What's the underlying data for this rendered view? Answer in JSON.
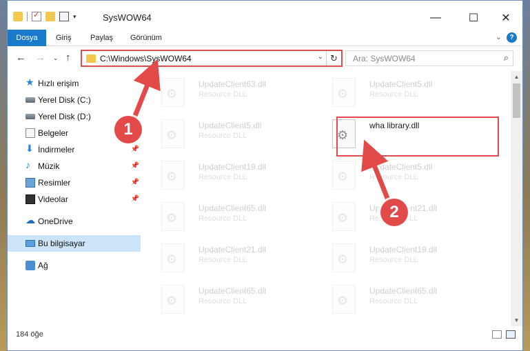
{
  "window": {
    "title": "SysWOW64",
    "controls": {
      "minimize": "—",
      "maximize": "☐",
      "close": "✕"
    }
  },
  "ribbon": {
    "tabs": [
      "Dosya",
      "Giriş",
      "Paylaş",
      "Görünüm"
    ],
    "help": "?"
  },
  "nav": {
    "address": "C:\\Windows\\SysWOW64",
    "search_placeholder": "Ara: SysWOW64"
  },
  "sidebar": {
    "items": [
      {
        "label": "Hızlı erişim",
        "icon": "star-icon"
      },
      {
        "label": "Yerel Disk (C:)",
        "icon": "disk-icon"
      },
      {
        "label": "Yerel Disk (D:)",
        "icon": "disk-icon"
      },
      {
        "label": "Belgeler",
        "icon": "document-icon"
      },
      {
        "label": "İndirmeler",
        "icon": "download-icon"
      },
      {
        "label": "Müzik",
        "icon": "music-icon"
      },
      {
        "label": "Resimler",
        "icon": "pictures-icon"
      },
      {
        "label": "Videolar",
        "icon": "video-icon"
      },
      {
        "label": "OneDrive",
        "icon": "cloud-icon"
      },
      {
        "label": "Bu bilgisayar",
        "icon": "computer-icon"
      },
      {
        "label": "Ağ",
        "icon": "network-icon"
      }
    ]
  },
  "files": [
    {
      "name": "UpdateClient63.dll",
      "type": "Resource DLL"
    },
    {
      "name": "UpdateClient5.dll",
      "type": "Resource DLL"
    },
    {
      "name": "UpdateClient5.dll",
      "type": "Resource DLL"
    },
    {
      "name": "wha library.dll",
      "type": ""
    },
    {
      "name": "UpdateClient19.dll",
      "type": "Resource DLL"
    },
    {
      "name": "UpdateClient5.dll",
      "type": "Resource DLL"
    },
    {
      "name": "UpdateClient65.dll",
      "type": "Resource DLL"
    },
    {
      "name": "UpdateClient21.dll",
      "type": "Resource DLL"
    },
    {
      "name": "UpdateClient21.dll",
      "type": "Resource DLL"
    },
    {
      "name": "UpdateClient19.dll",
      "type": "Resource DLL"
    },
    {
      "name": "UpdateClient65.dll",
      "type": "Resource DLL"
    },
    {
      "name": "UpdateClient65.dll",
      "type": "Resource DLL"
    }
  ],
  "status": {
    "count": "184 öğe"
  },
  "annotations": {
    "badge1": "1",
    "badge2": "2",
    "color": "#e24a4a"
  }
}
